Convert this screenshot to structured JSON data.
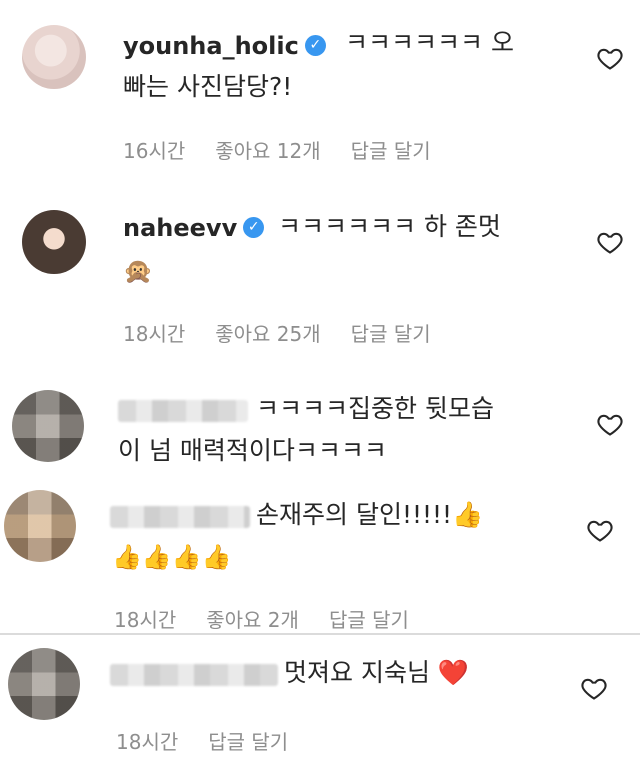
{
  "comments": [
    {
      "username": "younha_holic",
      "verified": true,
      "text_line1": "ㅋㅋㅋㅋㅋㅋ 오",
      "text_line2": "빠는 사진담당?!",
      "time": "16시간",
      "likes": "좋아요 12개",
      "reply": "답글 달기"
    },
    {
      "username": "naheevv",
      "verified": true,
      "text_line1": "ㅋㅋㅋㅋㅋㅋ 하 존멋",
      "text_line2": "🙊",
      "time": "18시간",
      "likes": "좋아요 25개",
      "reply": "답글 달기"
    },
    {
      "username": "",
      "text_line1": "ㅋㅋㅋㅋ집중한 뒷모습",
      "text_line2": "이 넘 매력적이다ㅋㅋㅋㅋ"
    },
    {
      "username": "",
      "text_line1": "손재주의 달인!!!!!👍",
      "text_line2": "👍👍👍👍",
      "time": "18시간",
      "likes": "좋아요 2개",
      "reply": "답글 달기"
    },
    {
      "username": "",
      "text_line1": "멋져요 지숙님 ❤️",
      "time": "18시간",
      "reply": "답글 달기"
    }
  ],
  "colors": {
    "text": "#262626",
    "meta": "#8e8e8e",
    "verified": "#3897f0",
    "divider": "#dbdbdb"
  },
  "icons": {
    "like": "heart-outline-icon",
    "verified": "verified-badge-icon"
  }
}
